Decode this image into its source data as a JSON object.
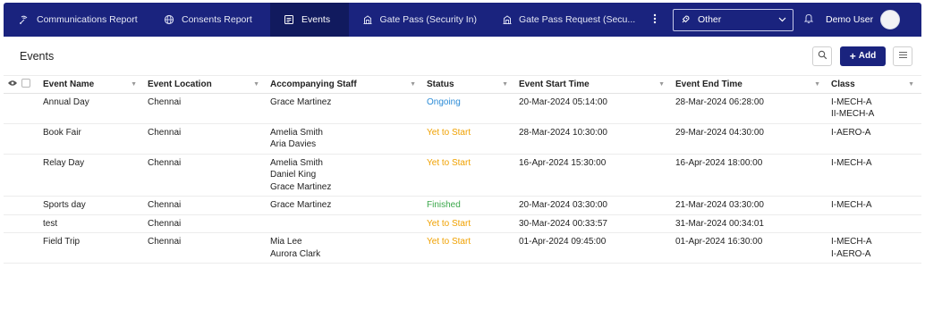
{
  "nav": {
    "tabs": [
      {
        "label": "Communications Report",
        "icon": "broadcast-icon"
      },
      {
        "label": "Consents Report",
        "icon": "globe-icon"
      },
      {
        "label": "Events",
        "icon": "events-list-icon"
      },
      {
        "label": "Gate Pass (Security In)",
        "icon": "building-icon"
      },
      {
        "label": "Gate Pass Request (Secu...",
        "icon": "building-icon"
      }
    ],
    "active_tab": "Events",
    "more_icon": "vertical-dots-icon",
    "org_select": {
      "value": "Other",
      "icon": "rocket-icon"
    },
    "user_name": "Demo User",
    "colors": {
      "nav_bg": "#1a237e",
      "active_tab_bg": "#111a5e"
    }
  },
  "page": {
    "title": "Events",
    "add_label": "Add"
  },
  "table": {
    "columns": [
      "Event Name",
      "Event Location",
      "Accompanying Staff",
      "Status",
      "Event Start Time",
      "Event End Time",
      "Class"
    ],
    "rows": [
      {
        "name": "Annual Day",
        "location": "Chennai",
        "staff": [
          "Grace Martinez"
        ],
        "status": "Ongoing",
        "status_kind": "ongoing",
        "start": "20-Mar-2024 05:14:00",
        "end": "28-Mar-2024 06:28:00",
        "class": [
          "I-MECH-A",
          "II-MECH-A"
        ]
      },
      {
        "name": "Book Fair",
        "location": "Chennai",
        "staff": [
          "Amelia Smith",
          "Aria Davies"
        ],
        "status": "Yet to Start",
        "status_kind": "yet",
        "start": "28-Mar-2024 10:30:00",
        "end": "29-Mar-2024 04:30:00",
        "class": [
          "I-AERO-A"
        ]
      },
      {
        "name": "Relay Day",
        "location": "Chennai",
        "staff": [
          "Amelia Smith",
          "Daniel King",
          "Grace Martinez"
        ],
        "status": "Yet to Start",
        "status_kind": "yet",
        "start": "16-Apr-2024 15:30:00",
        "end": "16-Apr-2024 18:00:00",
        "class": [
          "I-MECH-A"
        ]
      },
      {
        "name": "Sports day",
        "location": "Chennai",
        "staff": [
          "Grace Martinez"
        ],
        "status": "Finished",
        "status_kind": "finished",
        "start": "20-Mar-2024 03:30:00",
        "end": "21-Mar-2024 03:30:00",
        "class": [
          "I-MECH-A"
        ]
      },
      {
        "name": "test",
        "location": "Chennai",
        "staff": [],
        "status": "Yet to Start",
        "status_kind": "yet",
        "start": "30-Mar-2024 00:33:57",
        "end": "31-Mar-2024 00:34:01",
        "class": []
      },
      {
        "name": "Field Trip",
        "location": "Chennai",
        "staff": [
          "Mia Lee",
          "Aurora Clark"
        ],
        "status": "Yet to Start",
        "status_kind": "yet",
        "start": "01-Apr-2024 09:45:00",
        "end": "01-Apr-2024 16:30:00",
        "class": [
          "I-MECH-A",
          "I-AERO-A"
        ]
      }
    ],
    "status_colors": {
      "ongoing": "#2b8bd6",
      "yet": "#f0a100",
      "finished": "#3aa74a"
    }
  }
}
